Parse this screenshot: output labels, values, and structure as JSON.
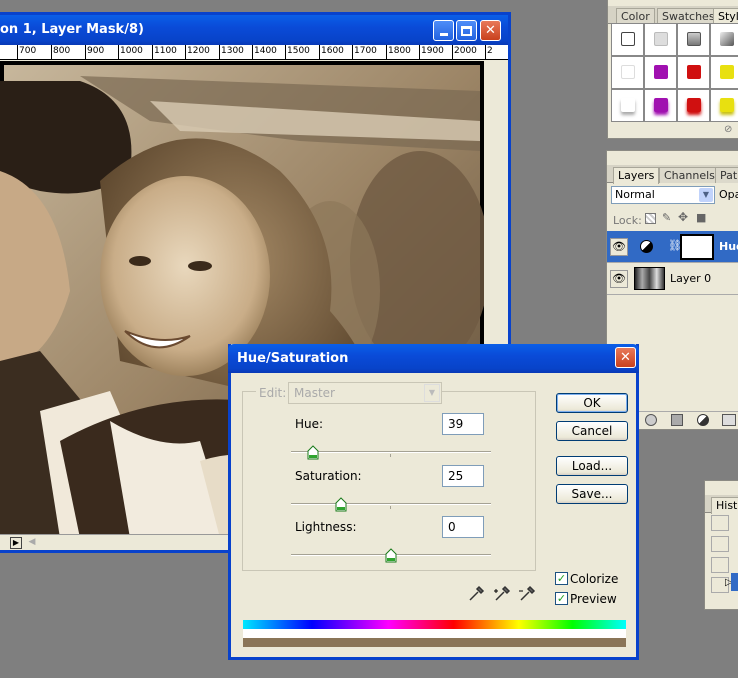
{
  "document": {
    "title": "on 1, Layer Mask/8)",
    "ruler_labels": [
      "700",
      "800",
      "900",
      "1000",
      "1100",
      "1200",
      "1300",
      "1400",
      "1500",
      "1600",
      "1700",
      "1800",
      "1900",
      "2000",
      "2"
    ]
  },
  "styles_panel": {
    "tabs": [
      "Color",
      "Swatches",
      "Style"
    ],
    "active_tab": "Style",
    "colors": {
      "magenta": "#a010b0",
      "red": "#d01010",
      "yellow": "#e8e010"
    }
  },
  "layers_panel": {
    "tabs": [
      "Layers",
      "Channels",
      "Path"
    ],
    "blend_mode": "Normal",
    "opacity_label": "Opa",
    "lock_label": "Lock:",
    "layers": [
      {
        "name": "Hue",
        "selected": true
      },
      {
        "name": "Layer 0",
        "selected": false
      }
    ]
  },
  "history_panel": {
    "tab": "Histo"
  },
  "dialog": {
    "title": "Hue/Saturation",
    "edit_label": "Edit:",
    "edit_value": "Master",
    "hue_label": "Hue:",
    "hue_value": "39",
    "saturation_label": "Saturation:",
    "saturation_value": "25",
    "lightness_label": "Lightness:",
    "lightness_value": "0",
    "buttons": {
      "ok": "OK",
      "cancel": "Cancel",
      "load": "Load...",
      "save": "Save..."
    },
    "colorize_label": "Colorize",
    "preview_label": "Preview",
    "colorize_checked": true,
    "preview_checked": true,
    "accent_color": "#0842cc"
  }
}
